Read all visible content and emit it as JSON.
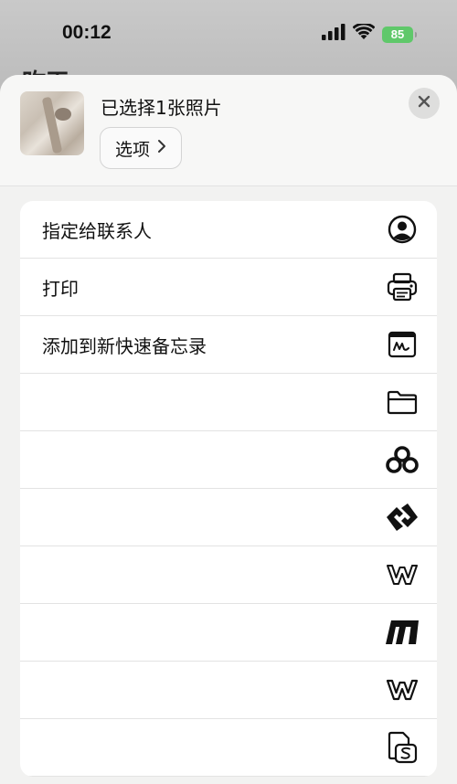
{
  "status_bar": {
    "time": "00:12",
    "battery": "85",
    "icons": [
      "cellular-signal-icon",
      "wifi-icon",
      "battery-icon"
    ]
  },
  "background": {
    "title_partial": "昨天"
  },
  "sheet": {
    "title": "已选择1张照片",
    "options_label": "选项",
    "close_icon": "close-icon"
  },
  "actions": [
    {
      "label": "指定给联系人",
      "icon": "person-circle-icon"
    },
    {
      "label": "打印",
      "icon": "printer-icon"
    },
    {
      "label": "添加到新快速备忘录",
      "icon": "quick-note-icon"
    },
    {
      "label": "",
      "icon": "folder-icon"
    },
    {
      "label": "",
      "icon": "baidu-netdisk-icon"
    },
    {
      "label": "",
      "icon": "diamond-link-icon"
    },
    {
      "label": "",
      "icon": "wps-w-outline-icon"
    },
    {
      "label": "",
      "icon": "slanted-bars-icon"
    },
    {
      "label": "",
      "icon": "wps-w-icon"
    },
    {
      "label": "",
      "icon": "document-s-icon"
    }
  ]
}
